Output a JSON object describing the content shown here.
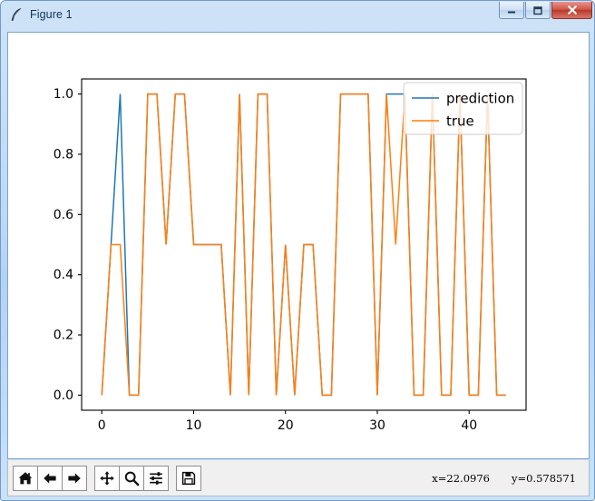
{
  "window": {
    "title": "Figure 1",
    "icon": "feather-icon",
    "buttons": [
      {
        "name": "minimize-button",
        "icon": "minimize-icon",
        "label": "Minimize"
      },
      {
        "name": "maximize-button",
        "icon": "maximize-icon",
        "label": "Maximize"
      },
      {
        "name": "close-button",
        "icon": "close-icon",
        "label": "X"
      }
    ]
  },
  "toolbar": {
    "buttons": [
      {
        "name": "home-button",
        "icon": "home-icon",
        "tooltip": "Reset original view"
      },
      {
        "name": "back-button",
        "icon": "arrow-left-icon",
        "tooltip": "Back to previous view"
      },
      {
        "name": "forward-button",
        "icon": "arrow-right-icon",
        "tooltip": "Forward to next view"
      },
      {
        "name": "pan-button",
        "icon": "move-icon",
        "tooltip": "Pan axes with left mouse, zoom with right"
      },
      {
        "name": "zoom-button",
        "icon": "magnifier-icon",
        "tooltip": "Zoom to rectangle"
      },
      {
        "name": "configure-subplots-button",
        "icon": "sliders-icon",
        "tooltip": "Configure subplots"
      },
      {
        "name": "save-button",
        "icon": "floppy-disk-icon",
        "tooltip": "Save the figure"
      }
    ],
    "cursor_x": "x=22.0976",
    "cursor_y": "y=0.578571"
  },
  "chart_data": {
    "type": "line",
    "title": "",
    "xlabel": "",
    "ylabel": "",
    "xlim": [
      -2.2,
      46.2
    ],
    "ylim": [
      -0.05,
      1.05
    ],
    "xticks": [
      0,
      10,
      20,
      30,
      40
    ],
    "xticklabels": [
      "0",
      "10",
      "20",
      "30",
      "40"
    ],
    "yticks": [
      0.0,
      0.2,
      0.4,
      0.6,
      0.8,
      1.0
    ],
    "yticklabels": [
      "0.0",
      "0.2",
      "0.4",
      "0.6",
      "0.8",
      "1.0"
    ],
    "grid": false,
    "legend_position": "upper right",
    "x": [
      0,
      1,
      2,
      3,
      4,
      5,
      6,
      7,
      8,
      9,
      10,
      11,
      12,
      13,
      14,
      15,
      16,
      17,
      18,
      19,
      20,
      21,
      22,
      23,
      24,
      25,
      26,
      27,
      28,
      29,
      30,
      31,
      32,
      33,
      34,
      35,
      36,
      37,
      38,
      39,
      40,
      41,
      42,
      43,
      44
    ],
    "series": [
      {
        "name": "prediction",
        "color": "#1f77b4",
        "linewidth": 1.5,
        "values": [
          0,
          0.5,
          1,
          0,
          0,
          1,
          1,
          0.5,
          1,
          1,
          0.5,
          0.5,
          0.5,
          0.5,
          0,
          1,
          0,
          1,
          1,
          0,
          0.5,
          0,
          0.5,
          0.5,
          0,
          0,
          1,
          1,
          1,
          1,
          0,
          1,
          1,
          1,
          0,
          0,
          1,
          0,
          0,
          1,
          0,
          0,
          1,
          0,
          0
        ]
      },
      {
        "name": "true",
        "color": "#ff7f0e",
        "linewidth": 1.5,
        "values": [
          0,
          0.5,
          0.5,
          0,
          0,
          1,
          1,
          0.5,
          1,
          1,
          0.5,
          0.5,
          0.5,
          0.5,
          0,
          1,
          0,
          1,
          1,
          0,
          0.5,
          0,
          0.5,
          0.5,
          0,
          0,
          1,
          1,
          1,
          1,
          0,
          1,
          0.5,
          1,
          0,
          0,
          1,
          0,
          0,
          1,
          0,
          0,
          1,
          0,
          0
        ]
      }
    ]
  }
}
